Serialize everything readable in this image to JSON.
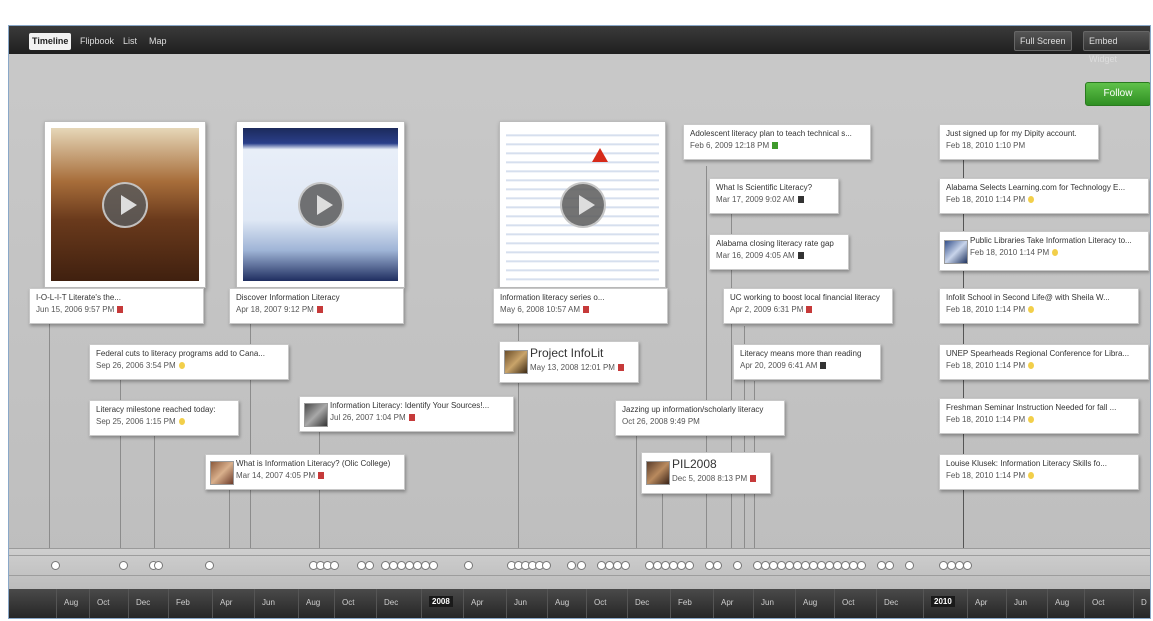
{
  "tabs": [
    "Timeline",
    "Flipbook",
    "List",
    "Map"
  ],
  "top_buttons": [
    "Full Screen",
    "Embed Widget"
  ],
  "follow_label": "Follow",
  "video_cards": [
    {
      "title": "I-O-L-I-T Literate's the...",
      "date": "Jun 15, 2006 9:57 PM"
    },
    {
      "title": "Discover Information Literacy",
      "date": "Apr 18, 2007 9:12 PM"
    },
    {
      "title": "Information literacy series o...",
      "date": "May 6, 2008 10:57 AM"
    }
  ],
  "events": [
    {
      "title": "Federal cuts to literacy programs add to Cana...",
      "date": "Sep 26, 2006 3:54 PM"
    },
    {
      "title": "Literacy milestone reached today:",
      "date": "Sep 25, 2006 1:15 PM"
    },
    {
      "title": "What is Information Literacy? (Olic College)",
      "date": "Mar 14, 2007 4:05 PM"
    },
    {
      "title": "Information Literacy: Identify Your Sources!...",
      "date": "Jul 26, 2007 1:04 PM"
    },
    {
      "title": "Project InfoLit",
      "date": "May 13, 2008 12:01 PM"
    },
    {
      "title": "Jazzing up information/scholarly literacy",
      "date": "Oct 26, 2008 9:49 PM"
    },
    {
      "title": "PIL2008",
      "date": "Dec 5, 2008 8:13 PM"
    },
    {
      "title": "Adolescent literacy plan to teach technical s...",
      "date": "Feb 6, 2009 12:18 PM"
    },
    {
      "title": "What Is Scientific Literacy?",
      "date": "Mar 17, 2009 9:02 AM"
    },
    {
      "title": "Alabama closing literacy rate gap",
      "date": "Mar 16, 2009 4:05 AM"
    },
    {
      "title": "UC working to boost local financial literacy",
      "date": "Apr 2, 2009 6:31 PM"
    },
    {
      "title": "Literacy means more than reading",
      "date": "Apr 20, 2009 6:41 AM"
    },
    {
      "title": "Just signed up for my Dipity account.",
      "date": "Feb 18, 2010 1:10 PM"
    },
    {
      "title": "Alabama Selects Learning.com for Technology E...",
      "date": "Feb 18, 2010 1:14 PM"
    },
    {
      "title": "Public Libraries Take Information Literacy to...",
      "date": "Feb 18, 2010 1:14 PM"
    },
    {
      "title": "Infolit School in Second Life@ with Sheila W...",
      "date": "Feb 18, 2010 1:14 PM"
    },
    {
      "title": "UNEP Spearheads Regional Conference for Libra...",
      "date": "Feb 18, 2010 1:14 PM"
    },
    {
      "title": "Freshman Seminar Instruction Needed for fall ...",
      "date": "Feb 18, 2010 1:14 PM"
    },
    {
      "title": "Louise Klusek: Information Literacy Skills fo...",
      "date": "Feb 18, 2010 1:14 PM"
    }
  ],
  "axis_labels": [
    "Aug",
    "Oct",
    "Dec",
    "Feb",
    "Apr",
    "Jun",
    "Aug",
    "Oct",
    "Dec",
    "2008",
    "Apr",
    "Jun",
    "Aug",
    "Oct",
    "Dec",
    "Feb",
    "Apr",
    "Jun",
    "Aug",
    "Oct",
    "Dec",
    "2010",
    "Apr",
    "Jun",
    "Aug",
    "Oct",
    "D"
  ],
  "axis_year_labels": [
    "2008",
    "2010"
  ],
  "colors": {
    "follow": "#3fa32f",
    "topbar": "#2a2a2a",
    "background": "#c4c4c4"
  }
}
